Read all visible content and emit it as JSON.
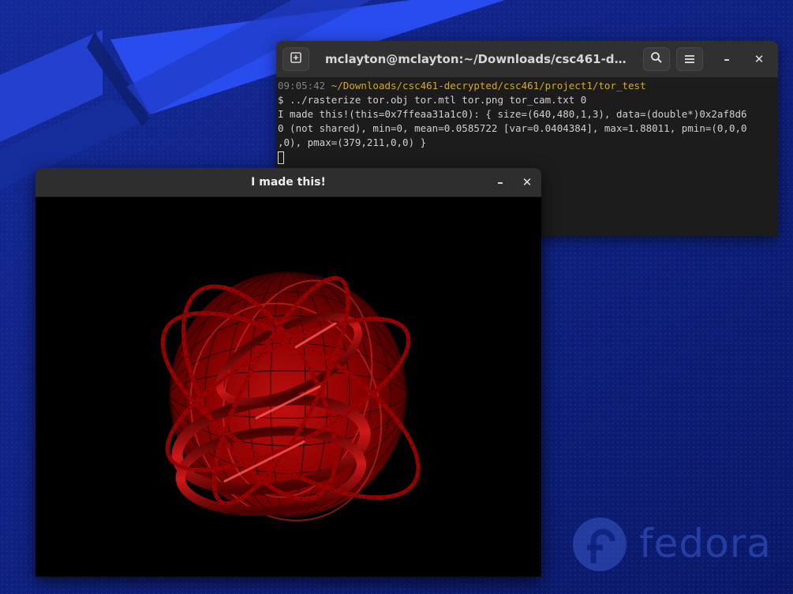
{
  "terminal": {
    "title": "mclayton@mclayton:~/Downloads/csc461-decrypted/...",
    "icons": {
      "new_tab": "new-tab-icon",
      "search": "search-icon",
      "menu": "hamburger-menu-icon",
      "minimize": "minimize-icon",
      "close": "close-icon"
    },
    "minimize_glyph": "–",
    "close_glyph": "✕",
    "timestamp": "09:05:42",
    "cwd": "~/Downloads/csc461-decrypted/csc461/project1/tor_test",
    "command": "$ ../rasterize tor.obj tor.mtl tor.png tor_cam.txt 0",
    "output": [
      "I made this!(this=0x7ffeaa31a1c0): { size=(640,480,1,3), data=(double*)0x2af8d6",
      "0 (not shared), min=0, mean=0.0585722 [var=0.0404384], max=1.88011, pmin=(0,0,0",
      ",0), pmax=(379,211,0,0) }"
    ]
  },
  "viewer": {
    "title": "I made this!",
    "minimize_glyph": "–",
    "close_glyph": "✕",
    "image_subject": "red-torus-render",
    "colors": {
      "torus": "#a80000",
      "highlight": "#ff4a4a",
      "background": "#000000"
    }
  },
  "desktop": {
    "logo_text": "fedora",
    "colors": {
      "wallpaper": "#0d1f7a",
      "stripe": "#2b4ef0"
    }
  }
}
